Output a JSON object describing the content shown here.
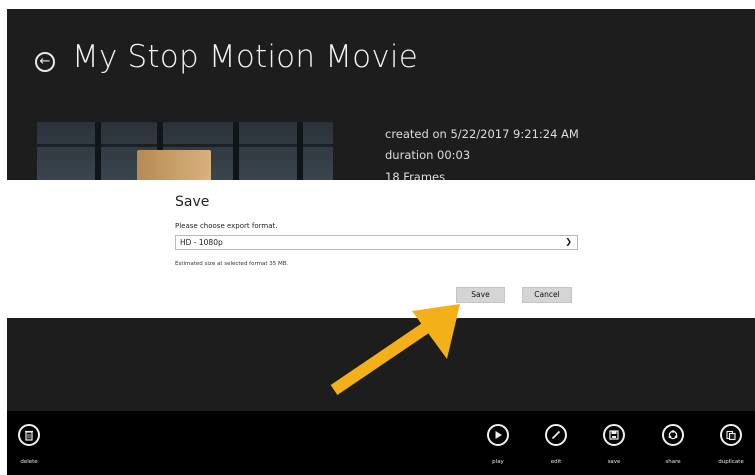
{
  "header": {
    "title": "My Stop Motion Movie"
  },
  "movie_info": {
    "created": "created on 5/22/2017 9:21:24 AM",
    "duration": "duration 00:03",
    "frames": "18 Frames"
  },
  "dialog": {
    "title": "Save",
    "prompt": "Please choose export format.",
    "format_value": "HD - 1080p",
    "size_note": "Estimated size at selected format 35 MB.",
    "save_label": "Save",
    "cancel_label": "Cancel"
  },
  "annotation": {
    "arrow_color": "#f4b019"
  },
  "appbar": {
    "delete_label": "delete",
    "play_label": "play",
    "edit_label": "edit",
    "save_label": "save",
    "share_label": "share",
    "duplicate_label": "duplicate"
  },
  "colors": {
    "background": "#1d1d1d",
    "dialog": "#ffffff",
    "appbar": "#000000"
  }
}
